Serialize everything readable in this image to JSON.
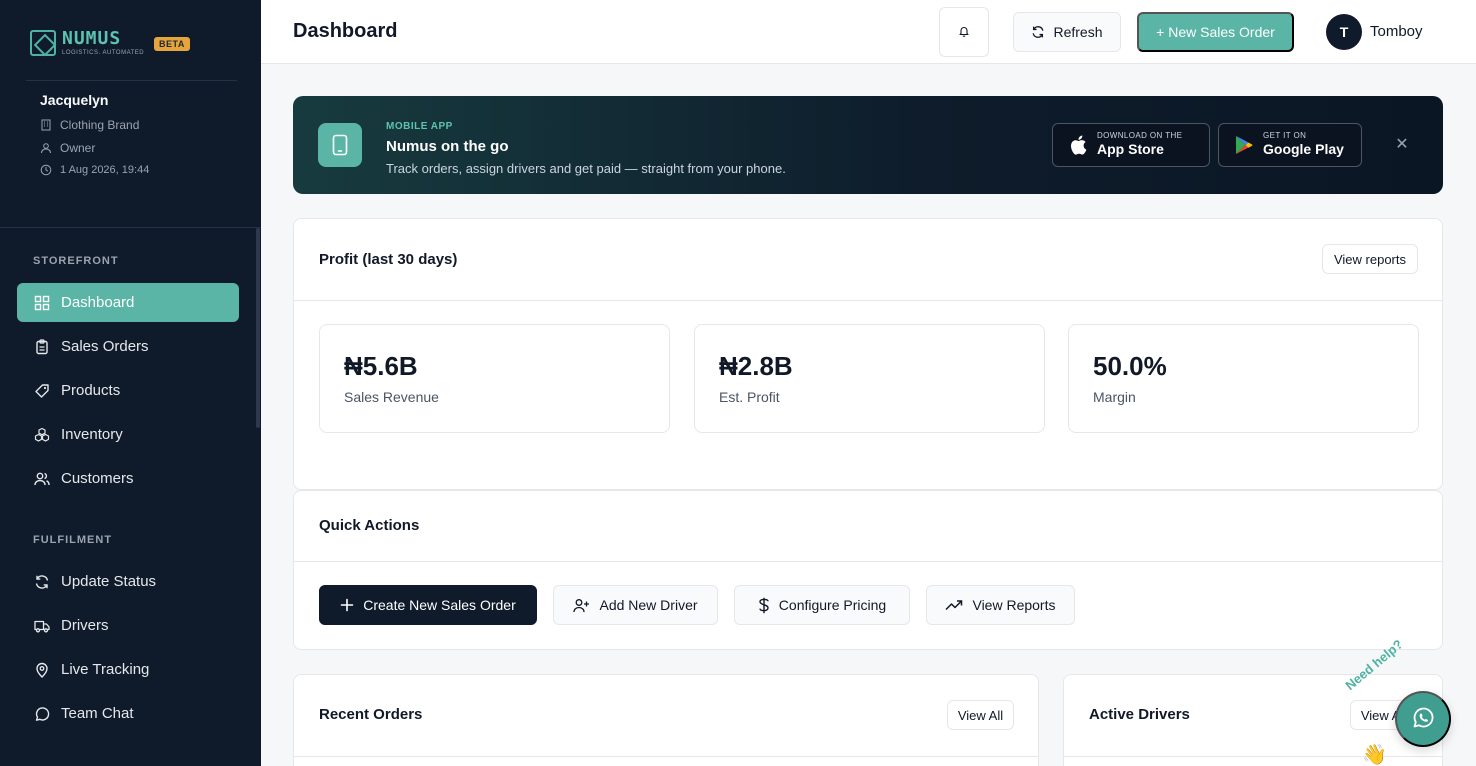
{
  "brand": {
    "name": "NUMUS",
    "tagline": "LOGISTICS. AUTOMATED",
    "badge": "BETA"
  },
  "user": {
    "name": "Jacquelyn",
    "business": "Clothing Brand",
    "role": "Owner",
    "datetime": "1 Aug 2026, 19:44"
  },
  "sidebar": {
    "sections": [
      {
        "label": "STOREFRONT",
        "items": [
          {
            "label": "Dashboard",
            "icon": "grid-icon",
            "active": true
          },
          {
            "label": "Sales Orders",
            "icon": "clipboard-icon"
          },
          {
            "label": "Products",
            "icon": "tag-icon"
          },
          {
            "label": "Inventory",
            "icon": "boxes-icon"
          },
          {
            "label": "Customers",
            "icon": "users-icon"
          }
        ]
      },
      {
        "label": "FULFILMENT",
        "items": [
          {
            "label": "Update Status",
            "icon": "refresh-icon"
          },
          {
            "label": "Drivers",
            "icon": "truck-icon"
          },
          {
            "label": "Live Tracking",
            "icon": "map-pin-icon"
          },
          {
            "label": "Team Chat",
            "icon": "chat-icon"
          }
        ]
      }
    ]
  },
  "header": {
    "title": "Dashboard",
    "refresh_label": "Refresh",
    "new_order_label": "+ New Sales Order",
    "avatar_initial": "T",
    "username": "Tomboy"
  },
  "banner": {
    "eyebrow": "MOBILE APP",
    "title": "Numus on the go",
    "subtitle": "Track orders, assign drivers and get paid — straight from your phone.",
    "app_store": {
      "small": "DOWNLOAD ON THE",
      "big": "App Store"
    },
    "google_play": {
      "small": "GET IT ON",
      "big": "Google Play"
    }
  },
  "profit": {
    "title": "Profit (last 30 days)",
    "view_reports_label": "View reports",
    "stats": [
      {
        "value": "₦5.6B",
        "label": "Sales Revenue"
      },
      {
        "value": "₦2.8B",
        "label": "Est. Profit"
      },
      {
        "value": "50.0%",
        "label": "Margin"
      }
    ]
  },
  "quick_actions": {
    "title": "Quick Actions",
    "buttons": [
      {
        "label": "Create New Sales Order",
        "icon": "plus-icon"
      },
      {
        "label": "Add New Driver",
        "icon": "user-plus-icon"
      },
      {
        "label": "Configure Pricing",
        "icon": "dollar-icon"
      },
      {
        "label": "View Reports",
        "icon": "trending-up-icon"
      }
    ]
  },
  "recent_orders": {
    "title": "Recent Orders",
    "view_all_label": "View All"
  },
  "active_drivers": {
    "title": "Active Drivers",
    "view_all_label": "View All"
  },
  "help": {
    "text": "Need help?"
  },
  "colors": {
    "accent": "#5ab5a6",
    "sidebar_bg": "#0f1a2a",
    "beta": "#e5a53b"
  }
}
